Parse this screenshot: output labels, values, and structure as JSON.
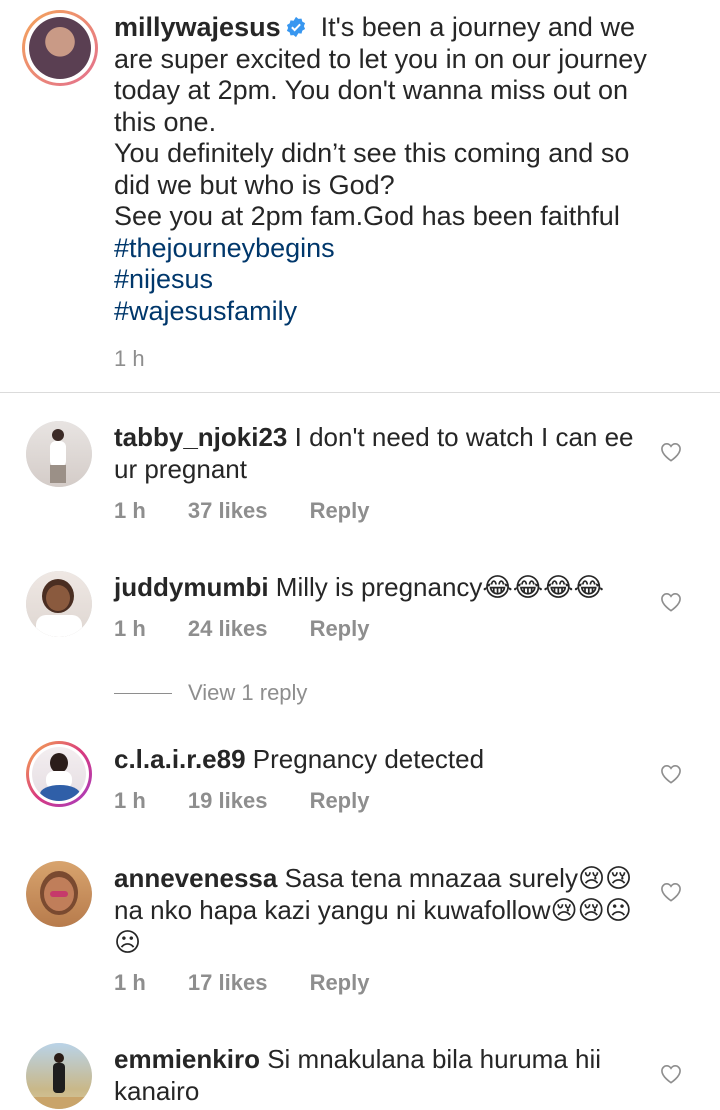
{
  "caption": {
    "username": "millywajesus",
    "verified_icon": "verified-badge-icon",
    "lines": [
      "It's been a journey and we",
      "are super excited to let you in on our journey",
      "today at 2pm. You don't wanna miss out on",
      "this one.",
      "You definitely didn’t see this coming and so",
      "did we but who is God?",
      "See you at 2pm fam.God has been faithful"
    ],
    "hashtags": [
      "#thejourneybegins",
      "#nijesus",
      "#wajesusfamily"
    ],
    "time": "1 h"
  },
  "comments": [
    {
      "username": "tabby_njoki23",
      "text": "I don't need to watch I can ee ur pregnant",
      "time": "1 h",
      "likes": "37 likes",
      "reply": "Reply"
    },
    {
      "username": "juddymumbi",
      "text": "Milly is pregnancy😂😂😂😂",
      "time": "1 h",
      "likes": "24 likes",
      "reply": "Reply",
      "view_replies": "View 1 reply"
    },
    {
      "username": "c.l.a.i.r.e89",
      "text": "Pregnancy detected",
      "time": "1 h",
      "likes": "19 likes",
      "reply": "Reply"
    },
    {
      "username": "annevenessa",
      "text": "Sasa tena mnazaa surely😢😢na nko hapa kazi yangu ni kuwafollow😢😢☹☹",
      "time": "1 h",
      "likes": "17 likes",
      "reply": "Reply"
    },
    {
      "username": "emmienkiro",
      "text": "Si mnakulana bila huruma hii kanairo"
    }
  ],
  "colors": {
    "text": "#262626",
    "muted": "#8e8e8e",
    "hashtag": "#00376b",
    "verified": "#3897f0"
  }
}
